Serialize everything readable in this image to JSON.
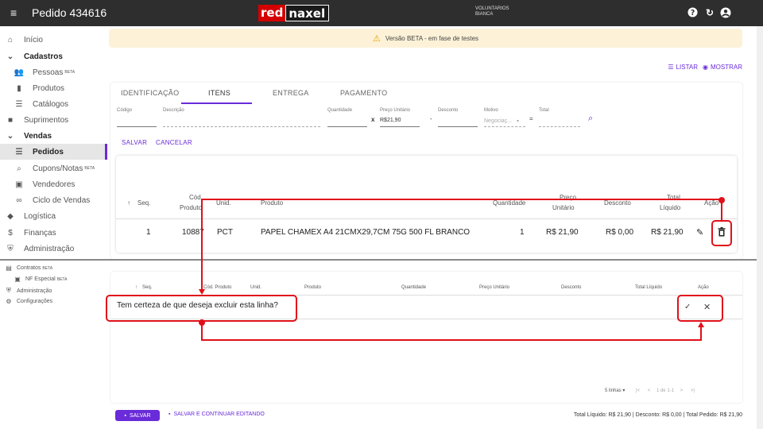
{
  "topbar": {
    "title": "Pedido 434616",
    "logo_red": "red",
    "logo_dark": "naxel",
    "user_line1": "VOLUNTARIOS",
    "user_line2": "BIANCA"
  },
  "sidebar": {
    "items": [
      {
        "label": "Início",
        "icon": "home-icon"
      },
      {
        "label": "Cadastros",
        "icon": "chevron-down-icon"
      },
      {
        "label": "Pessoas",
        "badge": "BETA",
        "icon": "people-icon"
      },
      {
        "label": "Produtos",
        "icon": "book-icon"
      },
      {
        "label": "Catálogos",
        "icon": "list-icon"
      },
      {
        "label": "Suprimentos",
        "icon": "box-icon"
      },
      {
        "label": "Vendas",
        "icon": "chevron-down-icon"
      },
      {
        "label": "Pedidos",
        "icon": "list-icon"
      },
      {
        "label": "Cupons/Notas",
        "badge": "BETA",
        "icon": "search-icon"
      },
      {
        "label": "Vendedores",
        "icon": "badge-icon"
      },
      {
        "label": "Ciclo de Vendas",
        "icon": "infinity-icon"
      },
      {
        "label": "Logística",
        "icon": "diamond-icon"
      },
      {
        "label": "Finanças",
        "icon": "dollar-icon"
      },
      {
        "label": "Administração",
        "icon": "shield-icon"
      }
    ]
  },
  "mini_sidebar": {
    "items": [
      {
        "label": "Contratos",
        "badge": "BETA"
      },
      {
        "label": "NF Especial",
        "badge": "BETA"
      },
      {
        "label": "Administração"
      },
      {
        "label": "Configurações"
      }
    ]
  },
  "banner": {
    "text": "Versão BETA - em fase de testes"
  },
  "toplinks": {
    "list": "LISTAR",
    "show": "MOSTRAR"
  },
  "tabs": [
    "IDENTIFICAÇÃO",
    "ITENS",
    "ENTREGA",
    "PAGAMENTO"
  ],
  "form": {
    "codigo_label": "Código",
    "descricao_label": "Descrição",
    "quantidade_label": "Quantidade",
    "preco_label": "Preço Unitário",
    "preco_value": "R$21,90",
    "desconto_label": "Desconto",
    "motivo_label": "Motivo",
    "motivo_placeholder": "Negociaç...",
    "total_label": "Total",
    "times": "x",
    "minus": "-",
    "equals": "=",
    "save": "SALVAR",
    "cancel": "CANCELAR"
  },
  "table": {
    "headers": {
      "seq": "Seq.",
      "cod1": "Cód.",
      "cod2": "Produto",
      "unid": "Unid.",
      "produto": "Produto",
      "quantidade": "Quantidade",
      "preco1": "Preço",
      "preco2": "Unitário",
      "desconto": "Desconto",
      "total1": "Total",
      "total2": "Líquido",
      "acao": "Ação"
    },
    "rows": [
      {
        "seq": "1",
        "cod": "10887",
        "unid": "PCT",
        "produto": "PAPEL CHAMEX A4 21CMX29,7CM 75G 500 FL BRANCO",
        "quantidade": "1",
        "preco": "R$ 21,90",
        "desconto": "R$ 0,00",
        "total": "R$ 21,90"
      }
    ]
  },
  "table2": {
    "headers": {
      "seq": "Seq.",
      "cod": "Cód. Produto",
      "unid": "Unid.",
      "produto": "Produto",
      "quantidade": "Quantidade",
      "preco": "Preço Unitário",
      "desconto": "Desconto",
      "total": "Total Líquido",
      "acao": "Ação"
    },
    "confirm_text": "Tem certeza de que deseja excluir esta linha?"
  },
  "pager": {
    "rows": "5 linhas",
    "range": "1 de 1-1"
  },
  "footer": {
    "save": "SALVAR",
    "save_continue": "SALVAR E CONTINUAR EDITANDO",
    "totals": "Total Líquido: R$ 21,90 | Desconto: R$ 0,00 | Total Pedido: R$ 21,90"
  },
  "colors": {
    "accent": "#6a2bd9",
    "annotation": "#e0101a",
    "topbar": "#2e2e2e",
    "banner": "#fdf2d8"
  }
}
